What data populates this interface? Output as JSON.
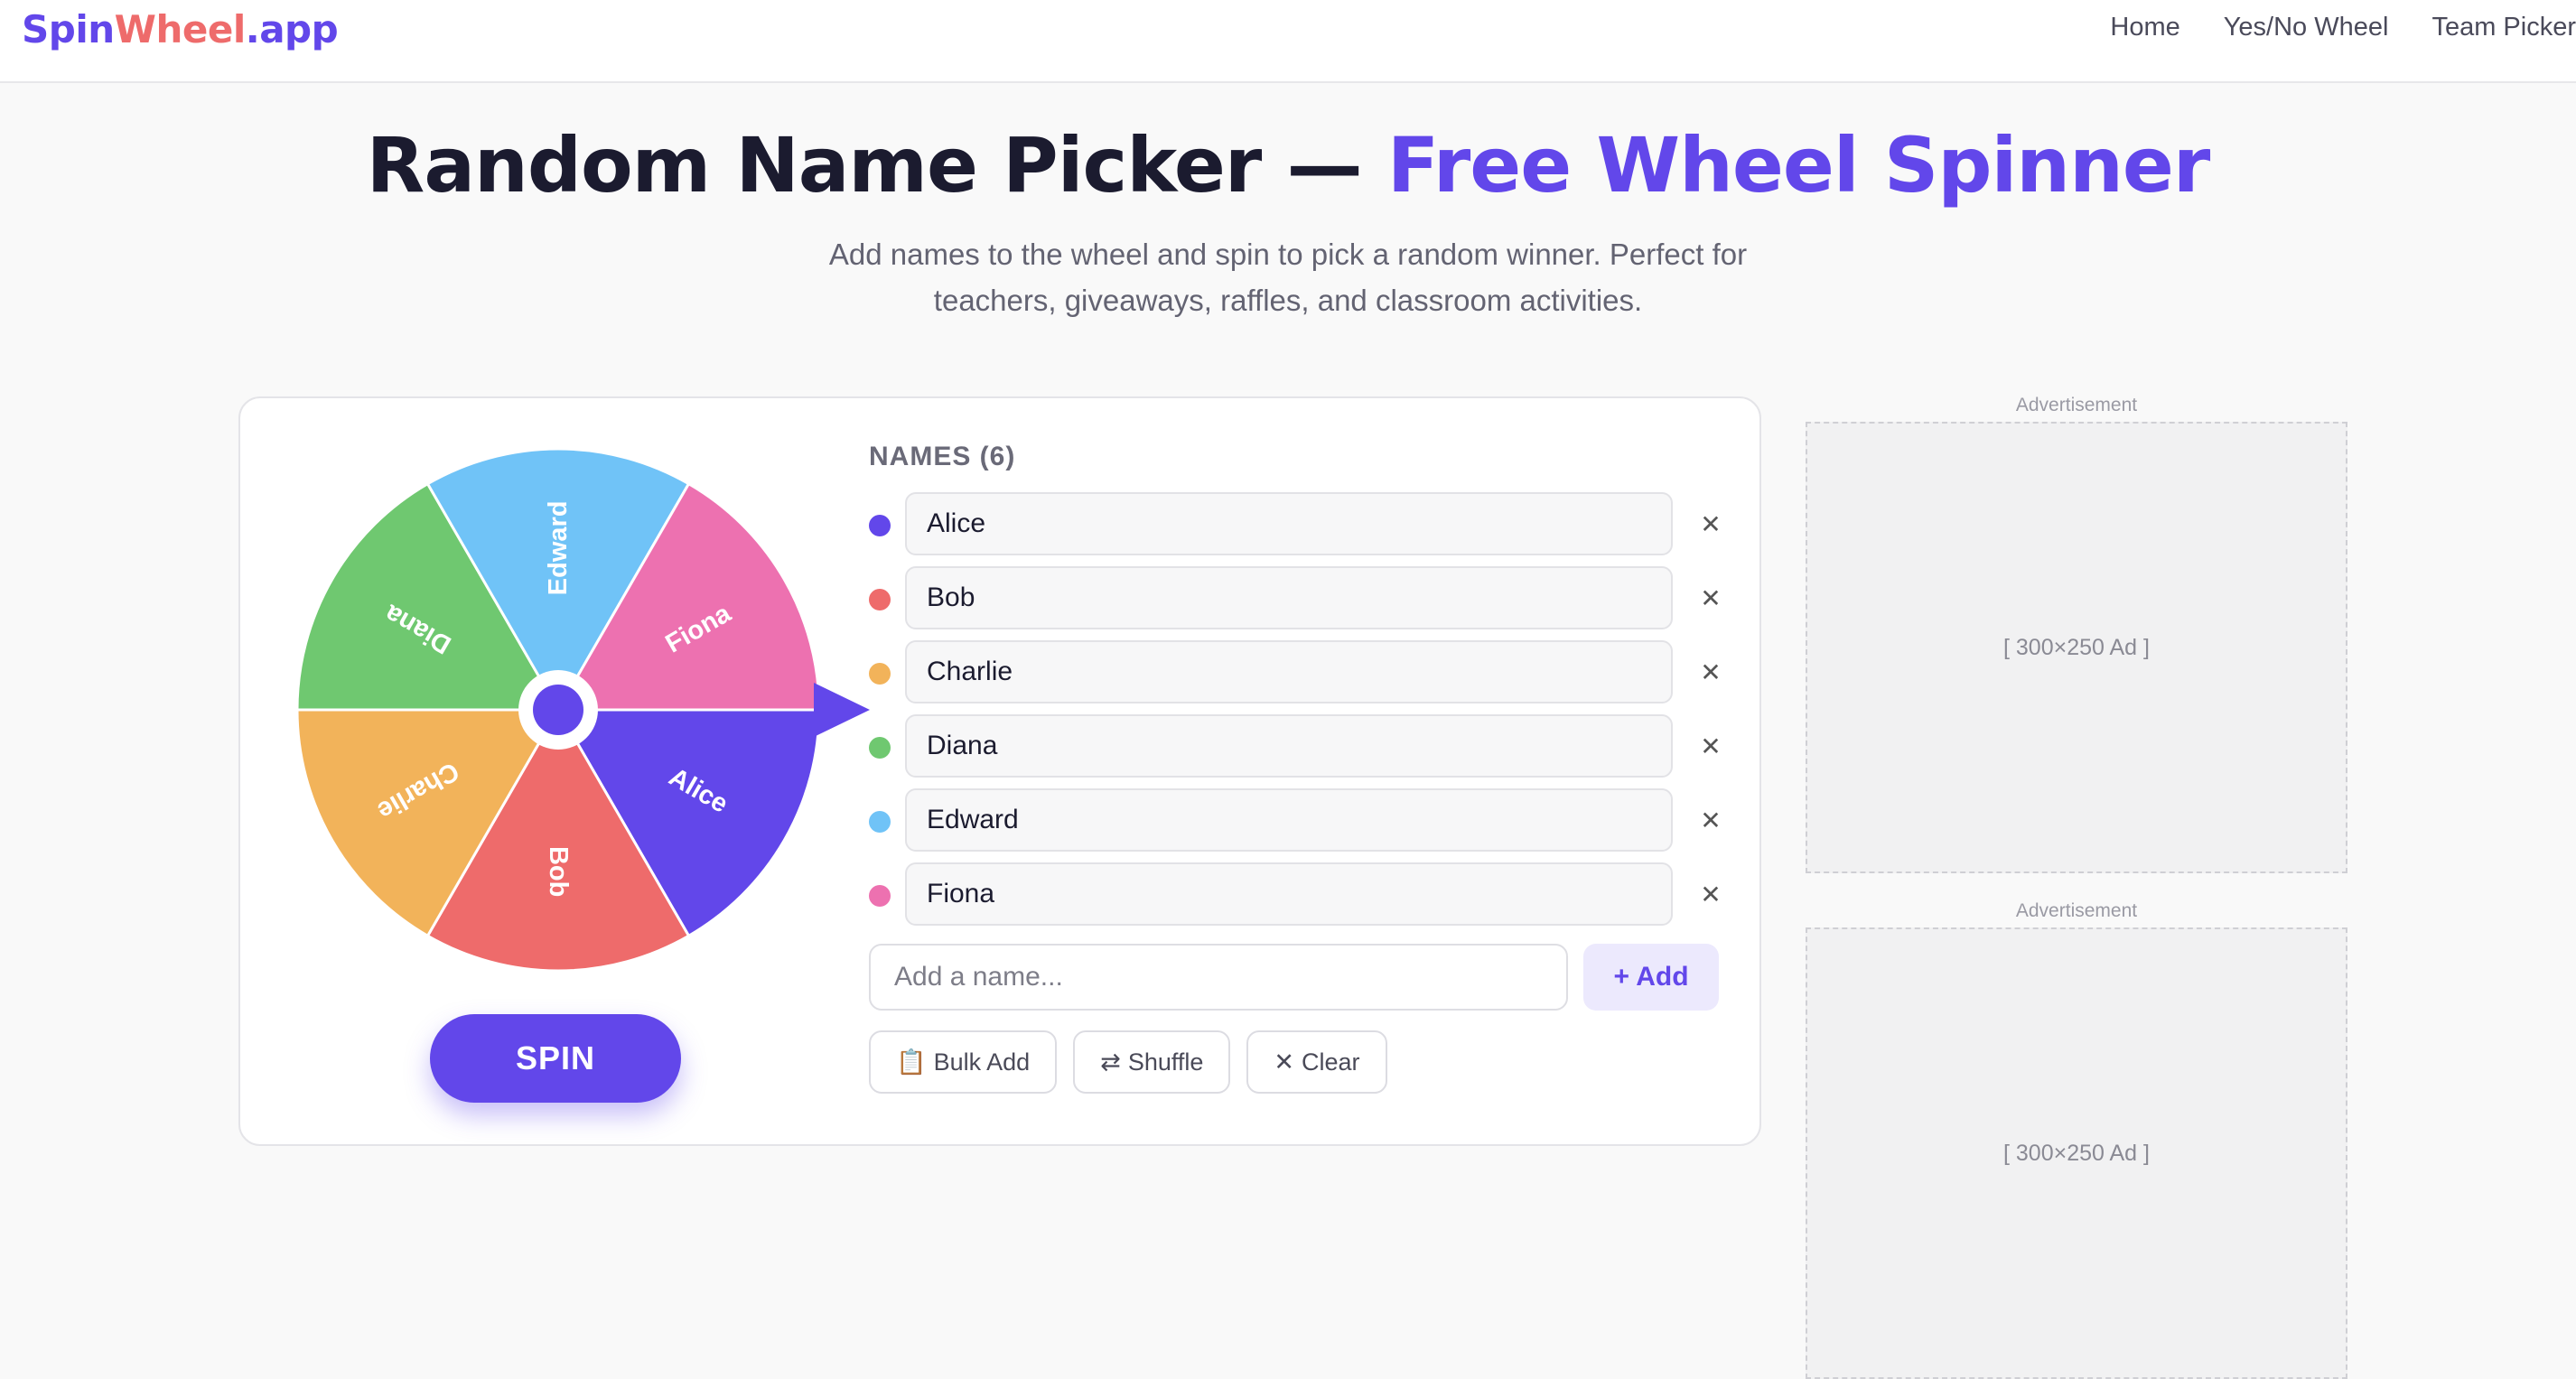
{
  "header": {
    "logo": {
      "part1": "Spin",
      "part2": "Wheel",
      "part3": ".app"
    },
    "nav": [
      "Home",
      "Yes/No Wheel",
      "Team Picker"
    ]
  },
  "hero": {
    "title_main": "Random Name Picker — ",
    "title_accent": "Free Wheel Spinner",
    "subtitle": "Add names to the wheel and spin to pick a random winner. Perfect for teachers, giveaways, raffles, and classroom activities."
  },
  "wheel": {
    "spin_label": "SPIN",
    "segments": [
      {
        "name": "Alice",
        "color": "#6247ea"
      },
      {
        "name": "Bob",
        "color": "#ee6b6b"
      },
      {
        "name": "Charlie",
        "color": "#f2b35a"
      },
      {
        "name": "Diana",
        "color": "#6fc870"
      },
      {
        "name": "Edward",
        "color": "#70c3f7"
      },
      {
        "name": "Fiona",
        "color": "#ed71b0"
      }
    ],
    "hub_color": "#6247ea",
    "pointer_color": "#6247ea"
  },
  "names_panel": {
    "label": "NAMES (6)",
    "remove_symbol": "✕",
    "add_placeholder": "Add a name...",
    "add_button": "+ Add",
    "tools": [
      {
        "icon": "📋",
        "label": "Bulk Add"
      },
      {
        "icon": "⇄",
        "label": "Shuffle"
      },
      {
        "icon": "✕",
        "label": "Clear"
      }
    ]
  },
  "ads": [
    {
      "label": "Advertisement",
      "placeholder": "[ 300×250 Ad ]"
    },
    {
      "label": "Advertisement",
      "placeholder": "[ 300×250 Ad ]"
    }
  ]
}
